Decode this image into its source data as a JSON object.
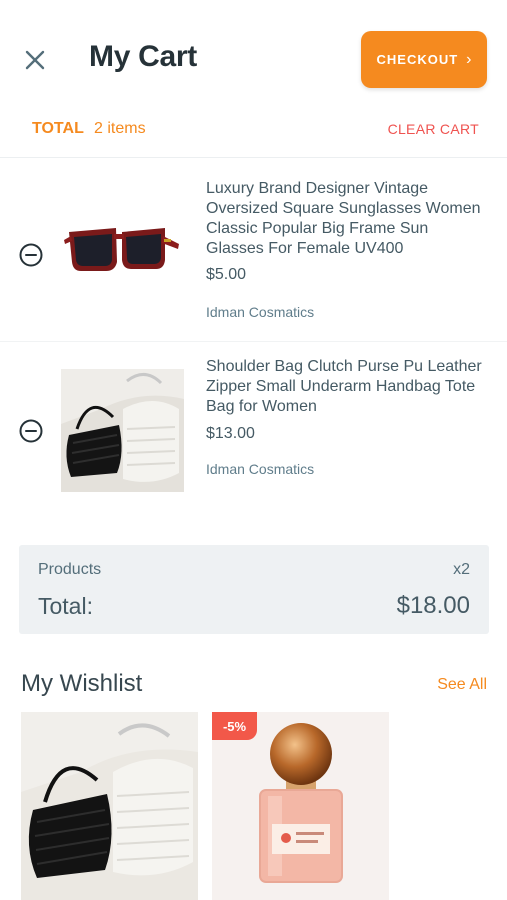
{
  "header": {
    "title": "My Cart",
    "checkout_label": "CHECKOUT",
    "checkout_chevron": "›",
    "close_icon": "close-icon"
  },
  "cart_summary_bar": {
    "total_label": "TOTAL",
    "item_count": "2 items",
    "clear_cart_label": "CLEAR CART"
  },
  "cart_items": [
    {
      "name": "Luxury Brand Designer Vintage Oversized Square Sunglasses Women Classic Popular Big Frame Sun Glasses For Female UV400",
      "price": "$5.00",
      "store": "Idman Cosmatics",
      "image": "sunglasses"
    },
    {
      "name": "Shoulder Bag Clutch Purse Pu Leather Zipper Small Underarm Handbag Tote Bag for Women",
      "price": "$13.00",
      "store": "Idman Cosmatics",
      "image": "handbags"
    }
  ],
  "summary": {
    "products_label": "Products",
    "products_qty": "x2",
    "total_label": "Total:",
    "total_value": "$18.00"
  },
  "wishlist": {
    "title": "My Wishlist",
    "see_all_label": "See All",
    "items": [
      {
        "image": "handbags",
        "badge": ""
      },
      {
        "image": "perfume",
        "badge": "-5%"
      }
    ]
  },
  "colors": {
    "accent": "#f58a1f",
    "danger": "#ef5350",
    "badge": "#f25849",
    "summary_bg": "#eef1f3"
  }
}
